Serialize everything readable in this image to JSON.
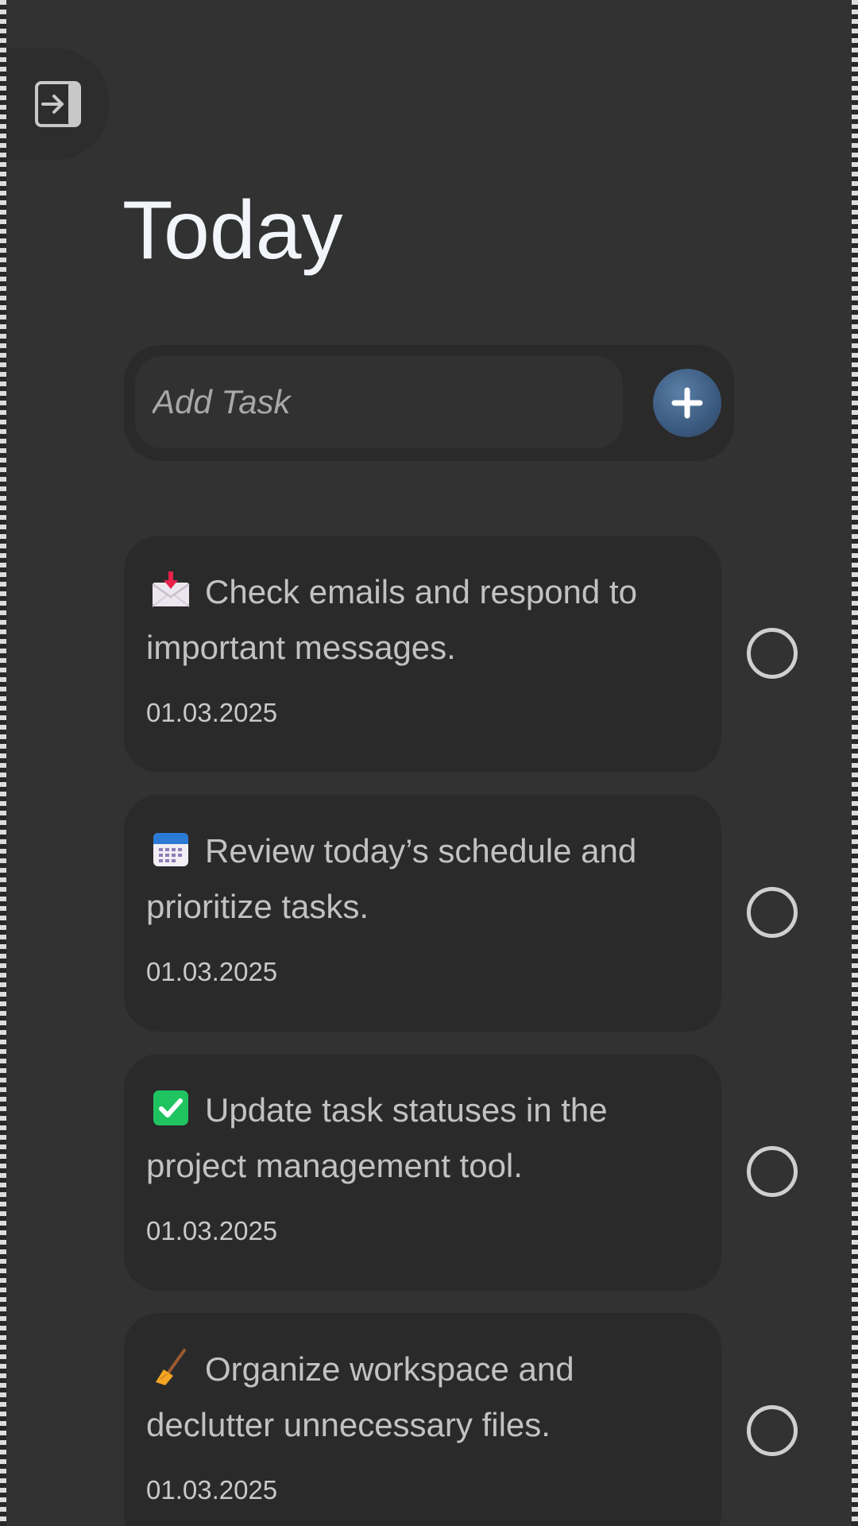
{
  "page": {
    "title": "Today"
  },
  "add_task": {
    "placeholder": "Add Task",
    "button_icon": "plus-icon"
  },
  "sidebar": {
    "toggle_icon": "sign-in-icon"
  },
  "tasks": [
    {
      "icon": "incoming-envelope-icon",
      "text": "Check emails and respond to important messages.",
      "date": "01.03.2025",
      "completed": false
    },
    {
      "icon": "calendar-icon",
      "text": "Review today’s schedule and prioritize tasks.",
      "date": "01.03.2025",
      "completed": false
    },
    {
      "icon": "check-mark-button-icon",
      "text": "Update task statuses in the project management tool.",
      "date": "01.03.2025",
      "completed": false
    },
    {
      "icon": "broom-icon",
      "text": "Organize workspace and declutter unnecessary files.",
      "date": "01.03.2025",
      "completed": false
    }
  ],
  "colors": {
    "background": "#323232",
    "card": "#2a2a2a",
    "accent": "#3b5a7f",
    "title": "#f2f6fb",
    "task_text": "#c2c2c2"
  }
}
